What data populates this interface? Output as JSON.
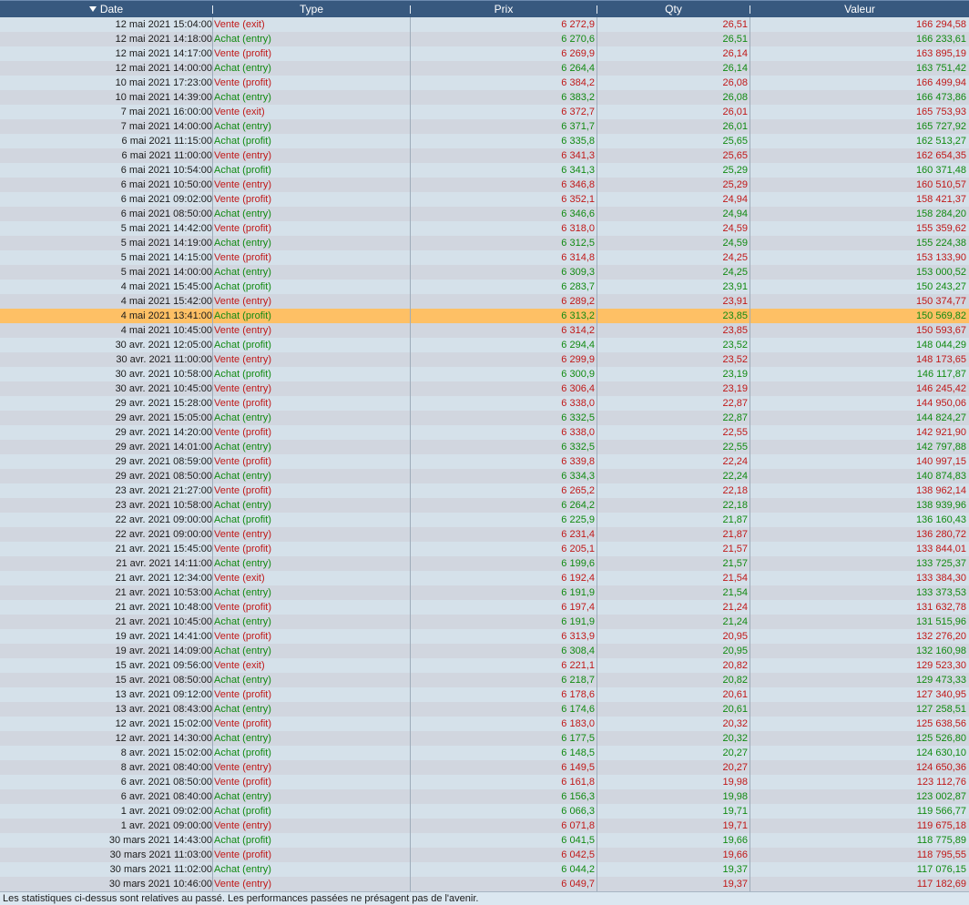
{
  "columns": {
    "date": "Date",
    "type": "Type",
    "prix": "Prix",
    "qty": "Qty",
    "valeur": "Valeur"
  },
  "colors": {
    "achat": "#118a11",
    "vente": "#c01818",
    "header_bg": "#38597f",
    "selected_row": "#fec065"
  },
  "selected_row_index": 20,
  "rows": [
    {
      "date": "12 mai 2021 15:04:00",
      "type": "Vente (exit)",
      "prix": "6 272,9",
      "qty": "26,51",
      "valeur": "166 294,58"
    },
    {
      "date": "12 mai 2021 14:18:00",
      "type": "Achat (entry)",
      "prix": "6 270,6",
      "qty": "26,51",
      "valeur": "166 233,61"
    },
    {
      "date": "12 mai 2021 14:17:00",
      "type": "Vente (profit)",
      "prix": "6 269,9",
      "qty": "26,14",
      "valeur": "163 895,19"
    },
    {
      "date": "12 mai 2021 14:00:00",
      "type": "Achat (entry)",
      "prix": "6 264,4",
      "qty": "26,14",
      "valeur": "163 751,42"
    },
    {
      "date": "10 mai 2021 17:23:00",
      "type": "Vente (profit)",
      "prix": "6 384,2",
      "qty": "26,08",
      "valeur": "166 499,94"
    },
    {
      "date": "10 mai 2021 14:39:00",
      "type": "Achat (entry)",
      "prix": "6 383,2",
      "qty": "26,08",
      "valeur": "166 473,86"
    },
    {
      "date": "7 mai 2021 16:00:00",
      "type": "Vente (exit)",
      "prix": "6 372,7",
      "qty": "26,01",
      "valeur": "165 753,93"
    },
    {
      "date": "7 mai 2021 14:00:00",
      "type": "Achat (entry)",
      "prix": "6 371,7",
      "qty": "26,01",
      "valeur": "165 727,92"
    },
    {
      "date": "6 mai 2021 11:15:00",
      "type": "Achat (profit)",
      "prix": "6 335,8",
      "qty": "25,65",
      "valeur": "162 513,27"
    },
    {
      "date": "6 mai 2021 11:00:00",
      "type": "Vente (entry)",
      "prix": "6 341,3",
      "qty": "25,65",
      "valeur": "162 654,35"
    },
    {
      "date": "6 mai 2021 10:54:00",
      "type": "Achat (profit)",
      "prix": "6 341,3",
      "qty": "25,29",
      "valeur": "160 371,48"
    },
    {
      "date": "6 mai 2021 10:50:00",
      "type": "Vente (entry)",
      "prix": "6 346,8",
      "qty": "25,29",
      "valeur": "160 510,57"
    },
    {
      "date": "6 mai 2021 09:02:00",
      "type": "Vente (profit)",
      "prix": "6 352,1",
      "qty": "24,94",
      "valeur": "158 421,37"
    },
    {
      "date": "6 mai 2021 08:50:00",
      "type": "Achat (entry)",
      "prix": "6 346,6",
      "qty": "24,94",
      "valeur": "158 284,20"
    },
    {
      "date": "5 mai 2021 14:42:00",
      "type": "Vente (profit)",
      "prix": "6 318,0",
      "qty": "24,59",
      "valeur": "155 359,62"
    },
    {
      "date": "5 mai 2021 14:19:00",
      "type": "Achat (entry)",
      "prix": "6 312,5",
      "qty": "24,59",
      "valeur": "155 224,38"
    },
    {
      "date": "5 mai 2021 14:15:00",
      "type": "Vente (profit)",
      "prix": "6 314,8",
      "qty": "24,25",
      "valeur": "153 133,90"
    },
    {
      "date": "5 mai 2021 14:00:00",
      "type": "Achat (entry)",
      "prix": "6 309,3",
      "qty": "24,25",
      "valeur": "153 000,52"
    },
    {
      "date": "4 mai 2021 15:45:00",
      "type": "Achat (profit)",
      "prix": "6 283,7",
      "qty": "23,91",
      "valeur": "150 243,27"
    },
    {
      "date": "4 mai 2021 15:42:00",
      "type": "Vente (entry)",
      "prix": "6 289,2",
      "qty": "23,91",
      "valeur": "150 374,77"
    },
    {
      "date": "4 mai 2021 13:41:00",
      "type": "Achat (profit)",
      "prix": "6 313,2",
      "qty": "23,85",
      "valeur": "150 569,82"
    },
    {
      "date": "4 mai 2021 10:45:00",
      "type": "Vente (entry)",
      "prix": "6 314,2",
      "qty": "23,85",
      "valeur": "150 593,67"
    },
    {
      "date": "30 avr. 2021 12:05:00",
      "type": "Achat (profit)",
      "prix": "6 294,4",
      "qty": "23,52",
      "valeur": "148 044,29"
    },
    {
      "date": "30 avr. 2021 11:00:00",
      "type": "Vente (entry)",
      "prix": "6 299,9",
      "qty": "23,52",
      "valeur": "148 173,65"
    },
    {
      "date": "30 avr. 2021 10:58:00",
      "type": "Achat (profit)",
      "prix": "6 300,9",
      "qty": "23,19",
      "valeur": "146 117,87"
    },
    {
      "date": "30 avr. 2021 10:45:00",
      "type": "Vente (entry)",
      "prix": "6 306,4",
      "qty": "23,19",
      "valeur": "146 245,42"
    },
    {
      "date": "29 avr. 2021 15:28:00",
      "type": "Vente (profit)",
      "prix": "6 338,0",
      "qty": "22,87",
      "valeur": "144 950,06"
    },
    {
      "date": "29 avr. 2021 15:05:00",
      "type": "Achat (entry)",
      "prix": "6 332,5",
      "qty": "22,87",
      "valeur": "144 824,27"
    },
    {
      "date": "29 avr. 2021 14:20:00",
      "type": "Vente (profit)",
      "prix": "6 338,0",
      "qty": "22,55",
      "valeur": "142 921,90"
    },
    {
      "date": "29 avr. 2021 14:01:00",
      "type": "Achat (entry)",
      "prix": "6 332,5",
      "qty": "22,55",
      "valeur": "142 797,88"
    },
    {
      "date": "29 avr. 2021 08:59:00",
      "type": "Vente (profit)",
      "prix": "6 339,8",
      "qty": "22,24",
      "valeur": "140 997,15"
    },
    {
      "date": "29 avr. 2021 08:50:00",
      "type": "Achat (entry)",
      "prix": "6 334,3",
      "qty": "22,24",
      "valeur": "140 874,83"
    },
    {
      "date": "23 avr. 2021 21:27:00",
      "type": "Vente (profit)",
      "prix": "6 265,2",
      "qty": "22,18",
      "valeur": "138 962,14"
    },
    {
      "date": "23 avr. 2021 10:58:00",
      "type": "Achat (entry)",
      "prix": "6 264,2",
      "qty": "22,18",
      "valeur": "138 939,96"
    },
    {
      "date": "22 avr. 2021 09:00:00",
      "type": "Achat (profit)",
      "prix": "6 225,9",
      "qty": "21,87",
      "valeur": "136 160,43"
    },
    {
      "date": "22 avr. 2021 09:00:00",
      "type": "Vente (entry)",
      "prix": "6 231,4",
      "qty": "21,87",
      "valeur": "136 280,72"
    },
    {
      "date": "21 avr. 2021 15:45:00",
      "type": "Vente (profit)",
      "prix": "6 205,1",
      "qty": "21,57",
      "valeur": "133 844,01"
    },
    {
      "date": "21 avr. 2021 14:11:00",
      "type": "Achat (entry)",
      "prix": "6 199,6",
      "qty": "21,57",
      "valeur": "133 725,37"
    },
    {
      "date": "21 avr. 2021 12:34:00",
      "type": "Vente (exit)",
      "prix": "6 192,4",
      "qty": "21,54",
      "valeur": "133 384,30"
    },
    {
      "date": "21 avr. 2021 10:53:00",
      "type": "Achat (entry)",
      "prix": "6 191,9",
      "qty": "21,54",
      "valeur": "133 373,53"
    },
    {
      "date": "21 avr. 2021 10:48:00",
      "type": "Vente (profit)",
      "prix": "6 197,4",
      "qty": "21,24",
      "valeur": "131 632,78"
    },
    {
      "date": "21 avr. 2021 10:45:00",
      "type": "Achat (entry)",
      "prix": "6 191,9",
      "qty": "21,24",
      "valeur": "131 515,96"
    },
    {
      "date": "19 avr. 2021 14:41:00",
      "type": "Vente (profit)",
      "prix": "6 313,9",
      "qty": "20,95",
      "valeur": "132 276,20"
    },
    {
      "date": "19 avr. 2021 14:09:00",
      "type": "Achat (entry)",
      "prix": "6 308,4",
      "qty": "20,95",
      "valeur": "132 160,98"
    },
    {
      "date": "15 avr. 2021 09:56:00",
      "type": "Vente (exit)",
      "prix": "6 221,1",
      "qty": "20,82",
      "valeur": "129 523,30"
    },
    {
      "date": "15 avr. 2021 08:50:00",
      "type": "Achat (entry)",
      "prix": "6 218,7",
      "qty": "20,82",
      "valeur": "129 473,33"
    },
    {
      "date": "13 avr. 2021 09:12:00",
      "type": "Vente (profit)",
      "prix": "6 178,6",
      "qty": "20,61",
      "valeur": "127 340,95"
    },
    {
      "date": "13 avr. 2021 08:43:00",
      "type": "Achat (entry)",
      "prix": "6 174,6",
      "qty": "20,61",
      "valeur": "127 258,51"
    },
    {
      "date": "12 avr. 2021 15:02:00",
      "type": "Vente (profit)",
      "prix": "6 183,0",
      "qty": "20,32",
      "valeur": "125 638,56"
    },
    {
      "date": "12 avr. 2021 14:30:00",
      "type": "Achat (entry)",
      "prix": "6 177,5",
      "qty": "20,32",
      "valeur": "125 526,80"
    },
    {
      "date": "8 avr. 2021 15:02:00",
      "type": "Achat (profit)",
      "prix": "6 148,5",
      "qty": "20,27",
      "valeur": "124 630,10"
    },
    {
      "date": "8 avr. 2021 08:40:00",
      "type": "Vente (entry)",
      "prix": "6 149,5",
      "qty": "20,27",
      "valeur": "124 650,36"
    },
    {
      "date": "6 avr. 2021 08:50:00",
      "type": "Vente (profit)",
      "prix": "6 161,8",
      "qty": "19,98",
      "valeur": "123 112,76"
    },
    {
      "date": "6 avr. 2021 08:40:00",
      "type": "Achat (entry)",
      "prix": "6 156,3",
      "qty": "19,98",
      "valeur": "123 002,87"
    },
    {
      "date": "1 avr. 2021 09:02:00",
      "type": "Achat (profit)",
      "prix": "6 066,3",
      "qty": "19,71",
      "valeur": "119 566,77"
    },
    {
      "date": "1 avr. 2021 09:00:00",
      "type": "Vente (entry)",
      "prix": "6 071,8",
      "qty": "19,71",
      "valeur": "119 675,18"
    },
    {
      "date": "30 mars 2021 14:43:00",
      "type": "Achat (profit)",
      "prix": "6 041,5",
      "qty": "19,66",
      "valeur": "118 775,89"
    },
    {
      "date": "30 mars 2021 11:03:00",
      "type": "Vente (profit)",
      "prix": "6 042,5",
      "qty": "19,66",
      "valeur": "118 795,55"
    },
    {
      "date": "30 mars 2021 11:02:00",
      "type": "Achat (entry)",
      "prix": "6 044,2",
      "qty": "19,37",
      "valeur": "117 076,15"
    },
    {
      "date": "30 mars 2021 10:46:00",
      "type": "Vente (entry)",
      "prix": "6 049,7",
      "qty": "19,37",
      "valeur": "117 182,69"
    }
  ],
  "footer": {
    "disclaimer": "Les statistiques ci-dessus sont relatives au passé. Les performances passées ne présagent pas de l'avenir."
  }
}
